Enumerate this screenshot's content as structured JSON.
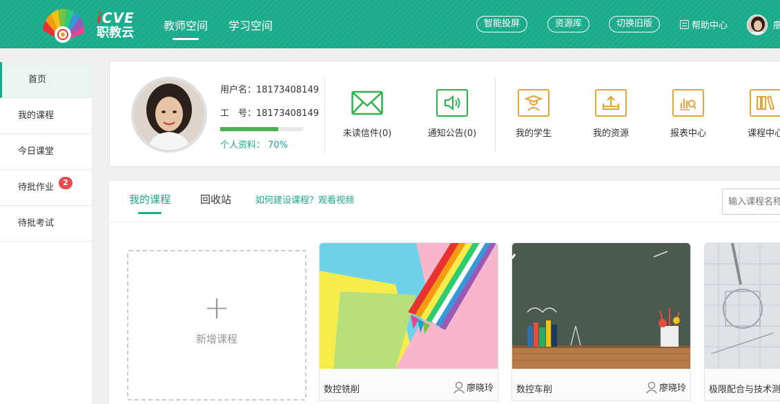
{
  "header": {
    "logo_en_i": "i",
    "logo_en_rest": "CVE",
    "logo_cn": "职教云",
    "nav": [
      {
        "label": "教师空间",
        "active": true
      },
      {
        "label": "学习空间",
        "active": false
      }
    ],
    "pills": [
      "智能投屏",
      "资源库",
      "切换旧版"
    ],
    "help_label": "帮助中心",
    "user_name_partial": "廖"
  },
  "sidebar": {
    "items": [
      {
        "label": "首页",
        "active": true
      },
      {
        "label": "我的课程"
      },
      {
        "label": "今日课堂"
      },
      {
        "label": "待批作业",
        "badge": "2"
      },
      {
        "label": "待批考试"
      }
    ]
  },
  "profile": {
    "username_label": "用户名：",
    "username": "18173408149",
    "jobno_label": "工　号：",
    "jobno": "18173408149",
    "progress_label": "个人资料：",
    "progress_text": "70%",
    "progress_fraction": 0.7,
    "quick": [
      {
        "label": "未读信件(0)",
        "icon": "mail-icon",
        "color": "green"
      },
      {
        "label": "通知公告(0)",
        "icon": "speaker-icon",
        "color": "green"
      },
      {
        "label": "我的学生",
        "icon": "graduate-icon",
        "color": "orange"
      },
      {
        "label": "我的资源",
        "icon": "upload-tray-icon",
        "color": "orange"
      },
      {
        "label": "报表中心",
        "icon": "chart-search-icon",
        "color": "orange"
      },
      {
        "label": "课程中心",
        "icon": "books-icon",
        "color": "orange"
      }
    ]
  },
  "courses": {
    "tabs": [
      {
        "label": "我的课程",
        "active": true
      },
      {
        "label": "回收站",
        "active": false
      }
    ],
    "help_link": "如何建设课程？观看视频",
    "search_placeholder": "输入课程名称",
    "add_label": "新增课程",
    "add_icon": "plus-icon",
    "items": [
      {
        "name": "数控铣削",
        "teacher": "廖晓玲"
      },
      {
        "name": "数控车削",
        "teacher": "廖晓玲"
      },
      {
        "name": "极限配合与技术测量",
        "teacher": ""
      }
    ]
  },
  "colors": {
    "brand": "#1aab8a",
    "green_icon": "#28b34a",
    "orange_icon": "#e0a53a",
    "badge": "#e84c4c"
  }
}
